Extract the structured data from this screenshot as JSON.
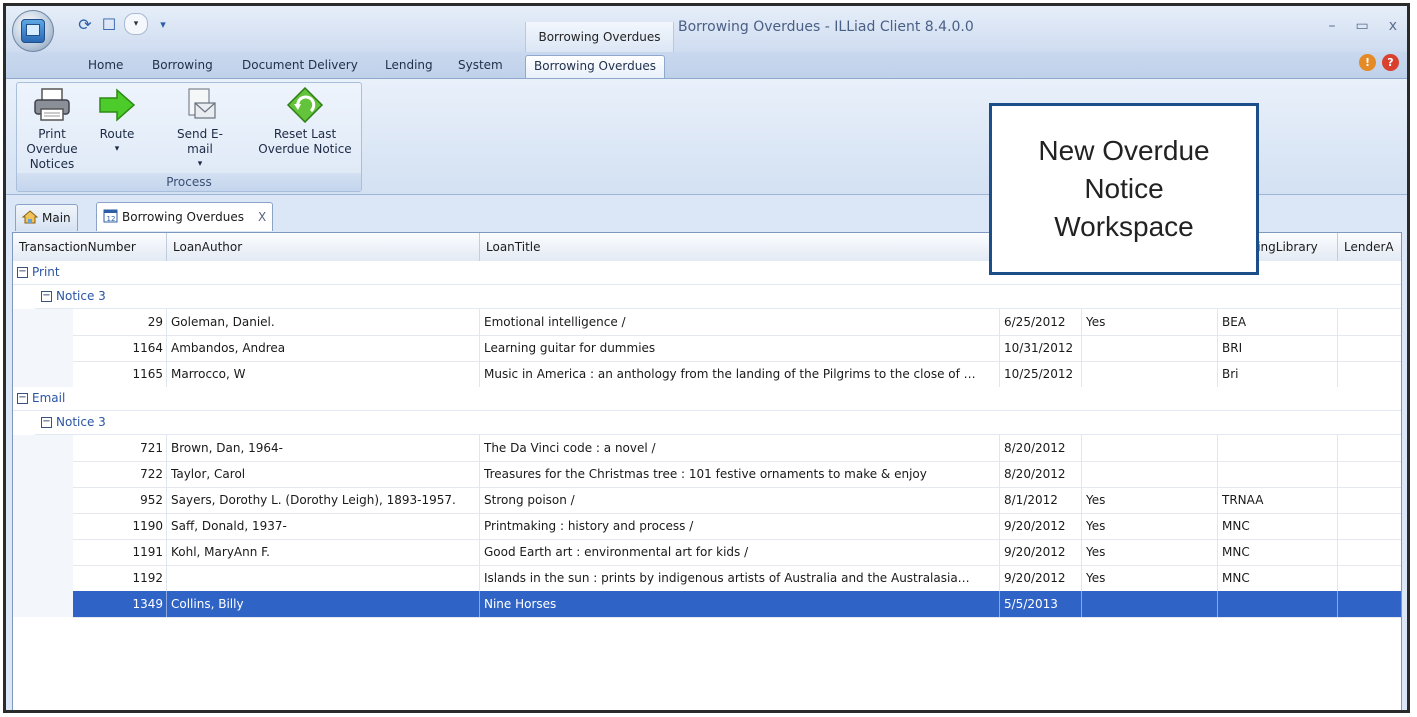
{
  "window": {
    "title": "Borrowing Overdues - ILLiad Client 8.4.0.0",
    "context_tab_title": "Borrowing Overdues",
    "controls": {
      "minimize": "–",
      "maximize": "▭",
      "close": "x"
    }
  },
  "ribbon": {
    "tabs": [
      "Home",
      "Borrowing",
      "Document Delivery",
      "Lending",
      "System",
      "Borrowing Overdues"
    ],
    "active_tab": "Borrowing Overdues",
    "group": {
      "label": "Process",
      "buttons": [
        {
          "line1": "Print Overdue",
          "line2": "Notices",
          "icon": "printer-icon"
        },
        {
          "line1": "Route",
          "line2": "▾",
          "icon": "arrow-right-icon"
        },
        {
          "line1": "Send E-mail",
          "line2": "▾",
          "icon": "email-icon"
        },
        {
          "line1": "Reset Last",
          "line2": "Overdue Notice",
          "icon": "reset-icon"
        }
      ]
    }
  },
  "doc_tabs": [
    {
      "label": "Main",
      "icon": "home-icon"
    },
    {
      "label": "Borrowing Overdues",
      "icon": "calendar-icon",
      "close": "X"
    }
  ],
  "grid": {
    "columns": [
      "TransactionNumber",
      "LoanAuthor",
      "LoanTitle",
      "",
      "",
      "ndingLibrary",
      "LenderA"
    ],
    "groups": [
      {
        "label": "Print",
        "sub": "Notice 3",
        "rows": [
          [
            "29",
            "Goleman, Daniel.",
            "Emotional intelligence /",
            "6/25/2012",
            "Yes",
            "BEA"
          ],
          [
            "1164",
            "Ambandos, Andrea",
            "Learning guitar for dummies",
            "10/31/2012",
            "",
            "BRI"
          ],
          [
            "1165",
            "Marrocco, W",
            "Music in America : an anthology from the landing of the Pilgrims to the close of …",
            "10/25/2012",
            "",
            "Bri"
          ]
        ]
      },
      {
        "label": "Email",
        "sub": "Notice 3",
        "rows": [
          [
            "721",
            "Brown, Dan, 1964-",
            "The Da Vinci code : a novel /",
            "8/20/2012",
            "",
            ""
          ],
          [
            "722",
            "Taylor, Carol",
            "Treasures for the Christmas tree : 101 festive ornaments to make & enjoy",
            "8/20/2012",
            "",
            ""
          ],
          [
            "952",
            "Sayers, Dorothy L. (Dorothy Leigh), 1893-1957.",
            "Strong poison /",
            "8/1/2012",
            "Yes",
            "TRNAA"
          ],
          [
            "1190",
            "Saff, Donald, 1937-",
            "Printmaking : history and process /",
            "9/20/2012",
            "Yes",
            "MNC"
          ],
          [
            "1191",
            "Kohl, MaryAnn F.",
            "Good Earth art : environmental art for kids /",
            "9/20/2012",
            "Yes",
            "MNC"
          ],
          [
            "1192",
            "",
            "Islands in the sun : prints by indigenous artists of Australia and the Australasia…",
            "9/20/2012",
            "Yes",
            "MNC"
          ],
          [
            "1349",
            "Collins, Billy",
            "Nine Horses",
            "5/5/2013",
            "",
            ""
          ]
        ]
      }
    ],
    "selected_transaction": "1349"
  },
  "callout": {
    "lines": [
      "New Overdue",
      "Notice",
      "Workspace"
    ]
  }
}
